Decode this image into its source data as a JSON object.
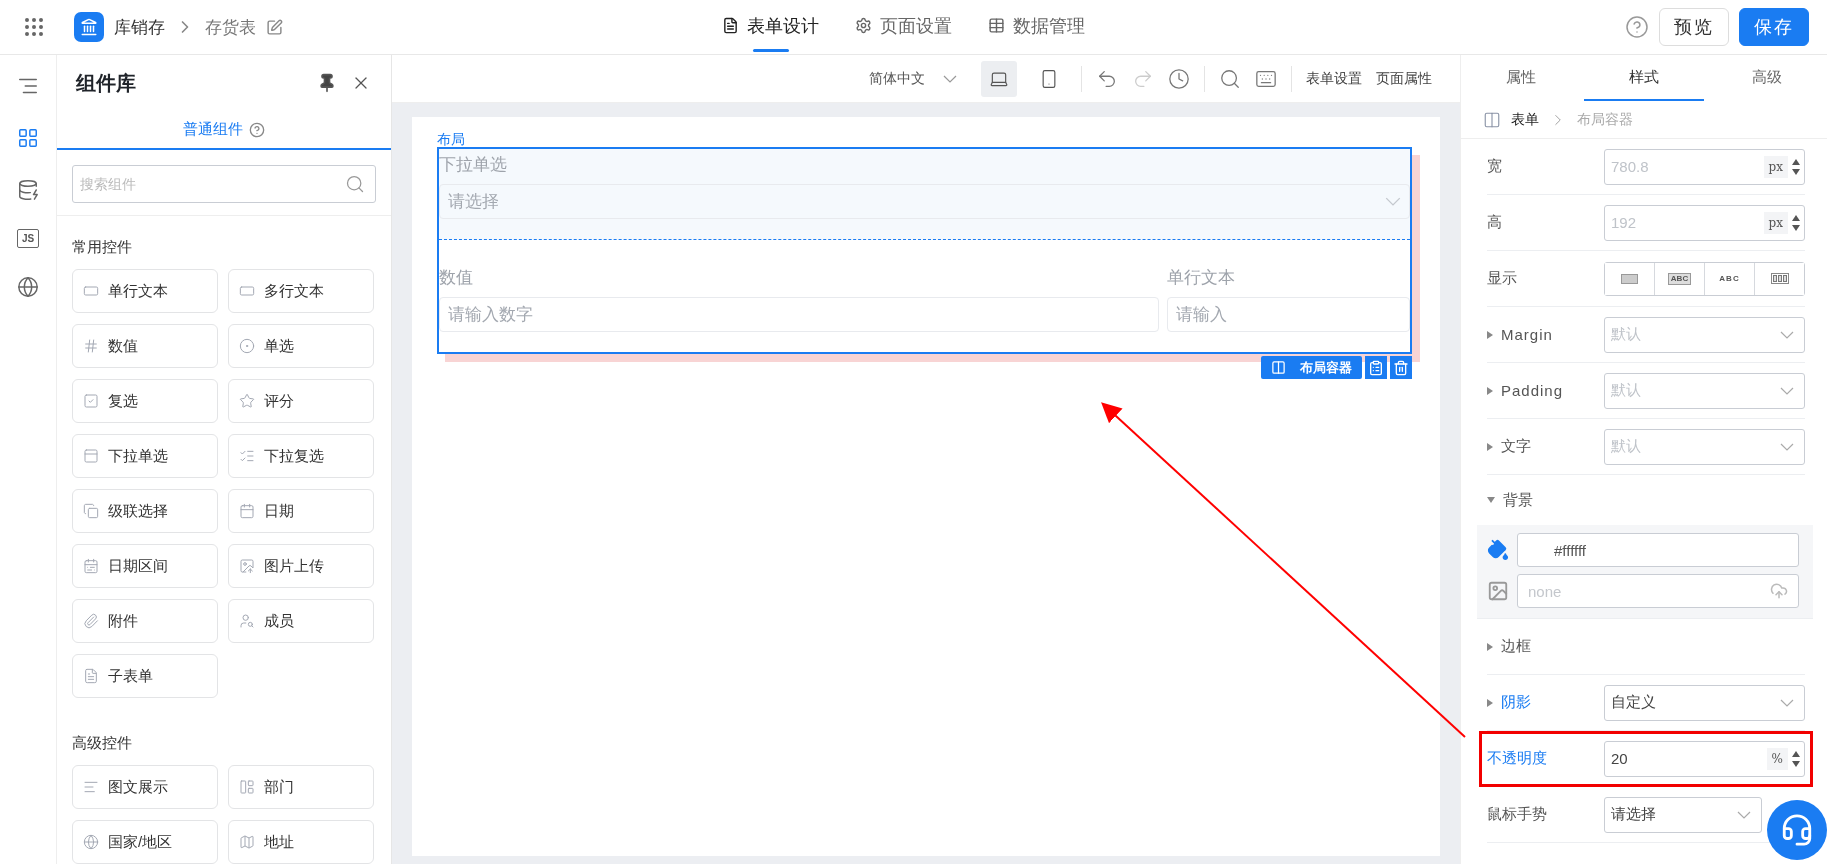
{
  "top_bar": {
    "app_name": "库销存",
    "page_name": "存货表",
    "tabs": [
      {
        "label": "表单设计",
        "selected": true
      },
      {
        "label": "页面设置",
        "selected": false
      },
      {
        "label": "数据管理",
        "selected": false
      }
    ],
    "buttons": [
      {
        "label": "预览",
        "kind": "secondary"
      },
      {
        "label": "保存",
        "kind": "primary"
      }
    ]
  },
  "rail": [
    {
      "selected": false
    },
    {
      "selected": true
    },
    {
      "selected": false
    },
    {
      "label": "JS",
      "selected": false
    },
    {
      "selected": false
    }
  ],
  "component_panel": {
    "title": "组件库",
    "tab": {
      "label": "普通组件",
      "selected": true
    },
    "search": {
      "placeholder": "搜索组件"
    },
    "groups": [
      {
        "title": "常用控件",
        "items": [
          "单行文本",
          "多行文本",
          "数值",
          "单选",
          "复选",
          "评分",
          "下拉单选",
          "下拉复选",
          "级联选择",
          "日期",
          "日期区间",
          "图片上传",
          "附件",
          "成员",
          "子表单"
        ]
      },
      {
        "title": "高级控件",
        "items": [
          "图文展示",
          "部门",
          "国家/地区",
          "地址"
        ]
      }
    ]
  },
  "canvas_toolbar": {
    "language": "简体中文",
    "devices": [
      {
        "kind": "desktop",
        "selected": true
      },
      {
        "kind": "mobile",
        "selected": false
      }
    ],
    "tools": [
      {
        "kind": "undo",
        "disabled": false
      },
      {
        "kind": "redo",
        "disabled": true
      },
      {
        "kind": "history",
        "disabled": false
      },
      {
        "kind": "search",
        "disabled": false
      },
      {
        "kind": "keyboard",
        "disabled": false
      }
    ],
    "actions": [
      "表单设置",
      "页面属性"
    ]
  },
  "form": {
    "layout_label": "布局",
    "container": {
      "selected": true,
      "tag": "布局容器",
      "sections": [
        {
          "fields": [
            {
              "label": "下拉单选",
              "kind": "select",
              "placeholder": "请选择"
            }
          ]
        },
        {
          "fields": [
            {
              "label": "数值",
              "kind": "input",
              "placeholder": "请输入数字"
            },
            {
              "label": "单行文本",
              "kind": "input",
              "placeholder": "请输入"
            }
          ]
        }
      ]
    }
  },
  "inspector": {
    "tabs": [
      {
        "label": "属性",
        "selected": false
      },
      {
        "label": "样式",
        "selected": true
      },
      {
        "label": "高级",
        "selected": false
      }
    ],
    "breadcrumb": [
      "表单",
      "布局容器"
    ],
    "rows": [
      {
        "label": "宽",
        "kind": "number",
        "placeholder": "780.8",
        "unit": "px",
        "modified": false,
        "highlighted": false
      },
      {
        "label": "高",
        "kind": "number",
        "placeholder": "192",
        "unit": "px",
        "modified": false,
        "highlighted": false
      },
      {
        "label": "显示",
        "kind": "segmented",
        "options": [
          {
            "kind": "block"
          },
          {
            "kind": "boxed-text",
            "label": "ABC"
          },
          {
            "kind": "text",
            "label": "ABC"
          },
          {
            "kind": "cells"
          }
        ],
        "modified": false,
        "highlighted": false
      },
      {
        "label": "Margin",
        "kind": "select",
        "expanded": false,
        "placeholder": "默认",
        "modified": false,
        "highlighted": false
      },
      {
        "label": "Padding",
        "kind": "select",
        "expanded": false,
        "placeholder": "默认",
        "modified": false,
        "highlighted": false
      },
      {
        "label": "文字",
        "kind": "select",
        "expanded": false,
        "placeholder": "默认",
        "modified": false,
        "highlighted": false
      },
      {
        "label": "背景",
        "kind": "background",
        "expanded": true,
        "color_text": "#ffffff",
        "image_placeholder": "none",
        "modified": false,
        "highlighted": false
      },
      {
        "label": "边框",
        "kind": "section",
        "expanded": false,
        "modified": false,
        "highlighted": false
      },
      {
        "label": "阴影",
        "kind": "select",
        "expanded": false,
        "value": "自定义",
        "modified": true,
        "highlighted": false
      },
      {
        "label": "不透明度",
        "kind": "number",
        "value": "20",
        "unit": "%",
        "modified": true,
        "highlighted": true
      },
      {
        "label": "鼠标手势",
        "kind": "select",
        "value": "请选择",
        "modified": false,
        "highlighted": false
      }
    ]
  }
}
